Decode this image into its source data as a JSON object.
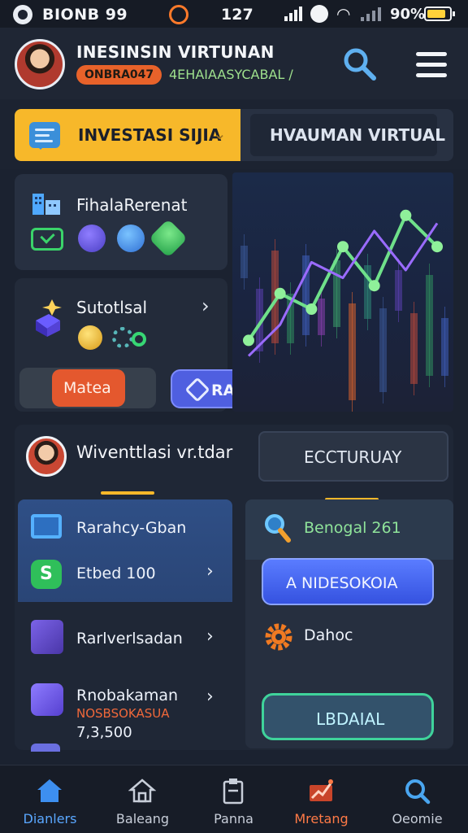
{
  "status_bar": {
    "carrier": "BIONB 99",
    "clock": "127",
    "battery": "90%"
  },
  "header": {
    "name": "INESINSIN VIRTUNAN",
    "badge": "ONBRA047",
    "subtext": "4EHAIAASYCABAL /"
  },
  "tabs": {
    "active_label": "INVESTASI SIJIA",
    "inactive_label": "HVAUMAN VIRTUAL"
  },
  "cards": {
    "finance_title": "FihalaRerenat",
    "stocks_title": "Sutotlsal",
    "matea_button": "Matea",
    "rated_button": "RALTED"
  },
  "lower": {
    "title": "Wiventtlasi vr.tdar",
    "right_button": "ECCTURUAY",
    "list": [
      {
        "title": "Rarahcy-Gban"
      },
      {
        "title": "Etbed 100"
      },
      {
        "title": "Rarlverlsadan"
      },
      {
        "title": "Rnobakaman",
        "sub": "NOSBSOKASUA",
        "value": "7,3,500"
      }
    ],
    "right_panel": {
      "search_title": "Benogal 261",
      "primary_button": "A  NIDESOKOIA",
      "gear_label": "Dahoc",
      "secondary_button": "LBDAIAL"
    }
  },
  "bottom_nav": [
    {
      "label": "Dianlers"
    },
    {
      "label": "Baleang"
    },
    {
      "label": "Panna"
    },
    {
      "label": "Mretang"
    },
    {
      "label": "Oeomie"
    }
  ],
  "colors": {
    "accent_yellow": "#f7b82a",
    "accent_orange": "#e4582e",
    "accent_blue": "#4f5fe0",
    "accent_green": "#3bd36a",
    "background": "#1b2230"
  },
  "chart_data": {
    "type": "line",
    "series": [
      {
        "values": [
          1.2,
          2.4,
          2.0,
          3.6,
          2.6,
          4.4,
          3.6
        ]
      },
      {
        "values": [
          0.8,
          1.6,
          3.2,
          2.8,
          4.0,
          3.0,
          4.2
        ]
      }
    ],
    "x": [
      0,
      1,
      2,
      3,
      4,
      5,
      6
    ],
    "ylim": [
      0,
      5
    ],
    "grid": false
  }
}
